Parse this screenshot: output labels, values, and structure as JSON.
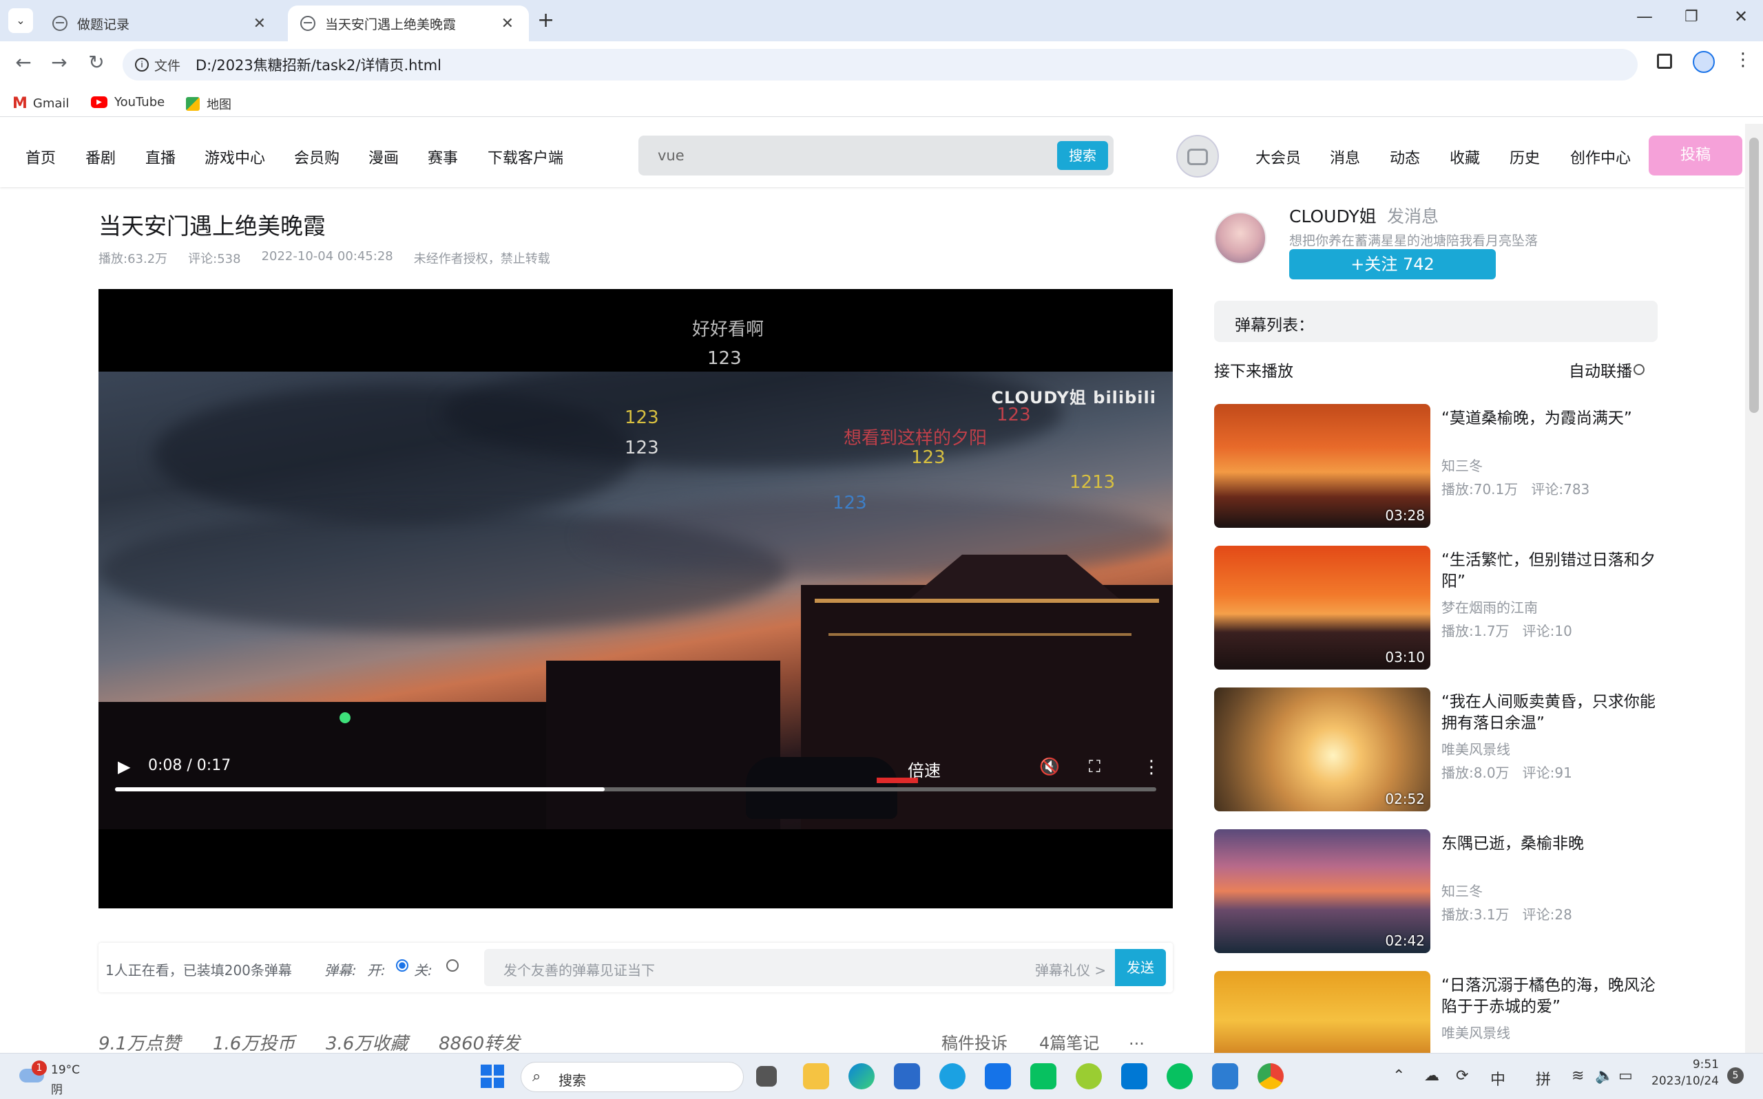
{
  "browser": {
    "tabs": [
      {
        "title": "做题记录",
        "active": false
      },
      {
        "title": "当天安门遇上绝美晚霞",
        "active": true
      }
    ],
    "address_prefix": "文件",
    "url": "D:/2023焦糖招新/task2/详情页.html",
    "bookmarks": [
      "Gmail",
      "YouTube",
      "地图"
    ]
  },
  "site_nav": {
    "left_items": [
      "首页",
      "番剧",
      "直播",
      "游戏中心",
      "会员购",
      "漫画",
      "赛事",
      "下载客户端"
    ],
    "search_value": "vue",
    "search_button": "搜索",
    "right_items": [
      "大会员",
      "消息",
      "动态",
      "收藏",
      "历史",
      "创作中心"
    ],
    "upload_button": "投稿"
  },
  "video": {
    "title": "当天安门遇上绝美晚霞",
    "plays": "播放:63.2万",
    "comments": "评论:538",
    "date": "2022-10-04 00:45:28",
    "copyright": "未经作者授权，禁止转载",
    "watermark": "CLOUDY姐 bilibili",
    "time": "0:08 / 0:17",
    "progress": 0.47,
    "speed_label": "倍速",
    "danmaku": [
      {
        "text": "好好看啊",
        "color": "#bbbbbb"
      },
      {
        "text": "123",
        "color": "#cccccc"
      },
      {
        "text": "123",
        "color": "#d8c040"
      },
      {
        "text": "123",
        "color": "#dddddd"
      },
      {
        "text": "想看到这样的夕阳",
        "color": "#c0404a"
      },
      {
        "text": "123",
        "color": "#c0404a"
      },
      {
        "text": "123",
        "color": "#d8c040"
      },
      {
        "text": "1213",
        "color": "#d8c040"
      },
      {
        "text": "123",
        "color": "#3d7fc8"
      }
    ]
  },
  "danmaku_bar": {
    "viewers": "1人正在看，已装填200条弹幕",
    "label": "弹幕:",
    "on_label": "开:",
    "off_label": "关:",
    "placeholder": "发个友善的弹幕见证当下",
    "etiquette": "弹幕礼仪 >",
    "send": "发送"
  },
  "stats": {
    "likes": "9.1万点赞",
    "coins": "1.6万投币",
    "favorites": "3.6万收藏",
    "shares": "8860转发",
    "report": "稿件投诉",
    "notes": "4篇笔记",
    "more": "..."
  },
  "uploader": {
    "name": "CLOUDY姐",
    "message": "发消息",
    "bio": "想把你养在蓄满星星的池塘陪我看月亮坠落",
    "follow": "+关注 742"
  },
  "sidebar": {
    "danmaku_list_title": "弹幕列表：",
    "next_label": "接下来播放",
    "autoplay_label": "自动联播",
    "recommendations": [
      {
        "title": "“莫道桑榆晚，为霞尚满天”",
        "author": "知三冬",
        "plays": "播放:70.1万",
        "comments": "评论:783",
        "duration": "03:28"
      },
      {
        "title": "“生活繁忙，但别错过日落和夕阳”",
        "author": "梦在烟雨的江南",
        "plays": "播放:1.7万",
        "comments": "评论:10",
        "duration": "03:10"
      },
      {
        "title": "“我在人间贩卖黄昏，只求你能拥有落日余温”",
        "author": "唯美风景线",
        "plays": "播放:8.0万",
        "comments": "评论:91",
        "duration": "02:52"
      },
      {
        "title": "东隅已逝，桑榆非晚",
        "author": "知三冬",
        "plays": "播放:3.1万",
        "comments": "评论:28",
        "duration": "02:42"
      },
      {
        "title": "“日落沉溺于橘色的海，晚风沦陷于于赤城的爱”",
        "author": "唯美风景线",
        "plays": "",
        "comments": "",
        "duration": ""
      }
    ]
  },
  "taskbar": {
    "weather_temp": "19°C",
    "weather_desc": "阴",
    "weather_badge": "1",
    "search": "搜索",
    "ime": "中",
    "ime2": "拼",
    "time": "9:51",
    "date": "2023/10/24",
    "notif": "5"
  },
  "colors": {
    "accent": "#1aa8d6",
    "upload_pink": "#f5a1d9",
    "follow_blue": "#1aa8d6"
  }
}
